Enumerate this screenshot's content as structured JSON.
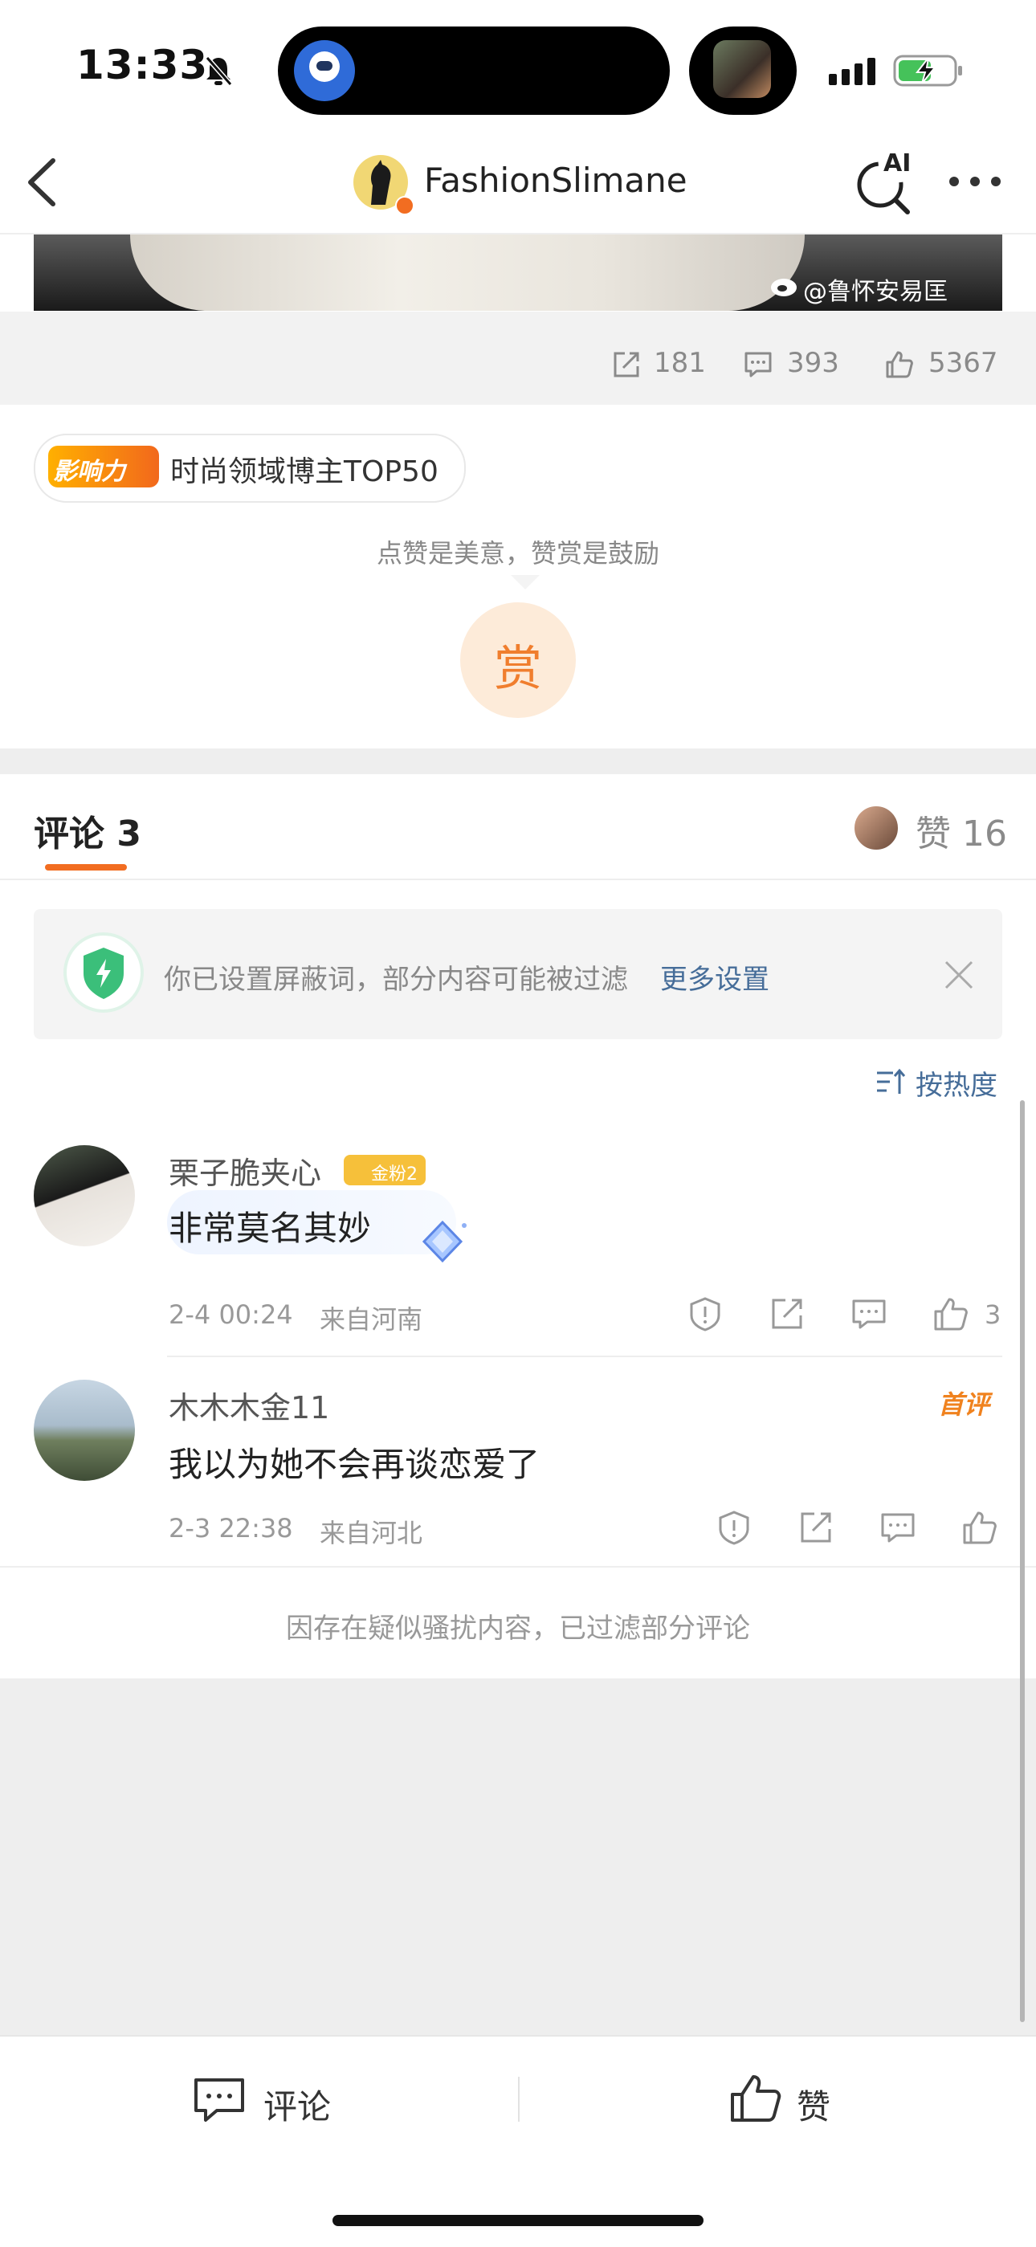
{
  "status_bar": {
    "time": "13:33"
  },
  "nav": {
    "title": "FashionSlimane",
    "ai_label": "AI"
  },
  "post": {
    "watermark": "@鲁怀安易匡",
    "stats": {
      "reposts": "181",
      "comments": "393",
      "likes": "5367"
    },
    "influence_badge": "影响力",
    "influence_text": "时尚领域博主TOP50",
    "reward_hint": "点赞是美意，赞赏是鼓励",
    "reward_button": "赏"
  },
  "comments_header": {
    "tab_label": "评论 3",
    "likes_label": "赞 16"
  },
  "filter_notice": {
    "text": "你已设置屏蔽词，部分内容可能被过滤",
    "link": "更多设置"
  },
  "sort": {
    "label": "按热度"
  },
  "comments": [
    {
      "user": "栗子脆夹心",
      "fan_badge": "金粉2",
      "text": "非常莫名其妙",
      "time": "2-4 00:24",
      "location": "来自河南",
      "likes": "3"
    },
    {
      "user": "木木木金11",
      "badge": "首评",
      "text": "我以为她不会再谈恋爱了",
      "time": "2-3 22:38",
      "location": "来自河北"
    }
  ],
  "filtered_note": "因存在疑似骚扰内容，已过滤部分评论",
  "bottom_bar": {
    "comment_label": "评论",
    "like_label": "赞"
  }
}
